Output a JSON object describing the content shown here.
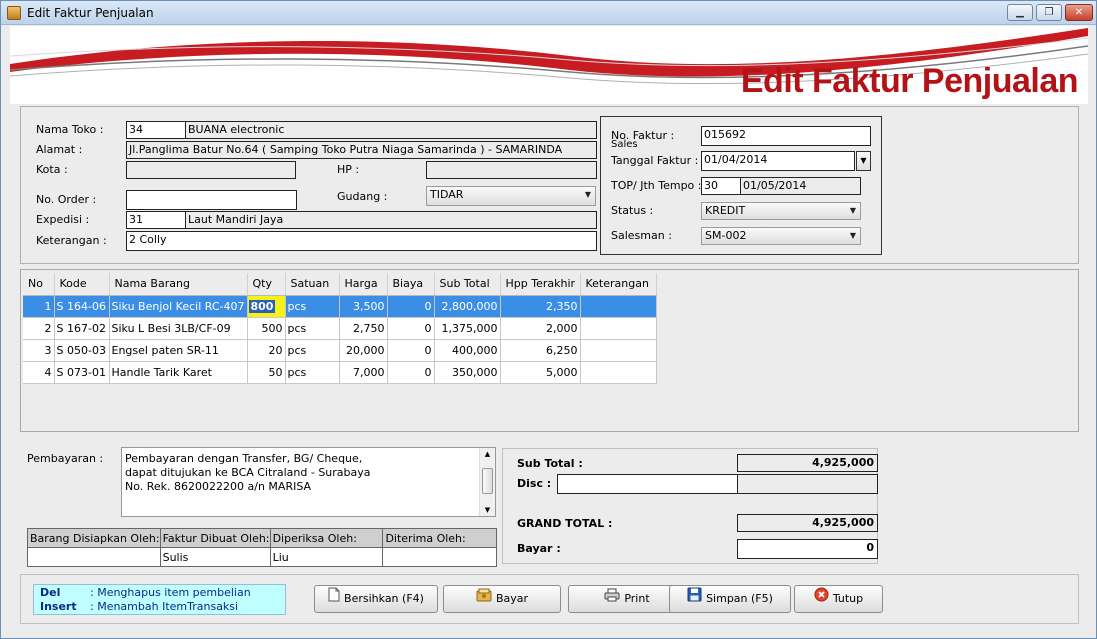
{
  "window": {
    "title": "Edit Faktur Penjualan"
  },
  "banner": {
    "title": "Edit Faktur Penjualan"
  },
  "customer": {
    "nama_toko_label": "Nama Toko :",
    "nama_toko_code": "34",
    "nama_toko_name": "BUANA electronic",
    "alamat_label": "Alamat :",
    "alamat_value": "Jl.Panglima Batur No.64  ( Samping Toko Putra Niaga Samarinda ) - SAMARINDA",
    "kota_label": "Kota :",
    "kota_value": "",
    "hp_label": "HP :",
    "hp_value": "",
    "no_order_label": "No. Order :",
    "no_order_value": "",
    "gudang_label": "Gudang :",
    "gudang_value": "TIDAR",
    "expedisi_label": "Expedisi :",
    "expedisi_code": "31",
    "expedisi_name": "Laut Mandiri Jaya",
    "keterangan_label": "Keterangan :",
    "keterangan_value": "2 Colly"
  },
  "invoice": {
    "no_faktur_label": "No. Faktur :",
    "sales_label": "Sales",
    "no_faktur_value": "015692",
    "tanggal_label": "Tanggal Faktur :",
    "tanggal_value": "01/04/2014",
    "top_label": "TOP/ Jth Tempo :",
    "top_days": "30",
    "jatuh_tempo": "01/05/2014",
    "status_label": "Status :",
    "status_value": "KREDIT",
    "salesman_label": "Salesman :",
    "salesman_value": "SM-002"
  },
  "items": {
    "columns": [
      "No",
      "Kode",
      "Nama Barang",
      "Qty",
      "Satuan",
      "Harga",
      "Biaya",
      "Sub Total",
      "Hpp Terakhir",
      "Keterangan"
    ],
    "rows": [
      {
        "no": "1",
        "kode": "S 164-06",
        "nama": "Siku Benjol Kecil RC-407",
        "qty": "800",
        "satuan": "pcs",
        "harga": "3,500",
        "biaya": "0",
        "subtotal": "2,800,000",
        "hpp": "2,350",
        "ket": ""
      },
      {
        "no": "2",
        "kode": "S 167-02",
        "nama": "Siku L Besi 3LB/CF-09",
        "qty": "500",
        "satuan": "pcs",
        "harga": "2,750",
        "biaya": "0",
        "subtotal": "1,375,000",
        "hpp": "2,000",
        "ket": ""
      },
      {
        "no": "3",
        "kode": "S 050-03",
        "nama": "Engsel paten SR-11",
        "qty": "20",
        "satuan": "pcs",
        "harga": "20,000",
        "biaya": "0",
        "subtotal": "400,000",
        "hpp": "6,250",
        "ket": ""
      },
      {
        "no": "4",
        "kode": "S 073-01",
        "nama": "Handle Tarik Karet",
        "qty": "50",
        "satuan": "pcs",
        "harga": "7,000",
        "biaya": "0",
        "subtotal": "350,000",
        "hpp": "5,000",
        "ket": ""
      }
    ]
  },
  "payment": {
    "label": "Pembayaran :",
    "line1": "Pembayaran dengan Transfer, BG/ Cheque,",
    "line2": "dapat ditujukan ke BCA Citraland - Surabaya",
    "line3": "No. Rek. 8620022200 a/n MARISA"
  },
  "signatures": {
    "headers": [
      "Barang Disiapkan Oleh:",
      "Faktur Dibuat Oleh:",
      "Diperiksa Oleh:",
      "Diterima Oleh:"
    ],
    "values": [
      "",
      "Sulis",
      "Liu",
      ""
    ]
  },
  "totals": {
    "subtotal_label": "Sub Total :",
    "subtotal_value": "4,925,000",
    "disc_label": "Disc :",
    "disc_value": "",
    "grand_label": "GRAND TOTAL :",
    "grand_value": "4,925,000",
    "bayar_label": "Bayar :",
    "bayar_value": "0"
  },
  "hints": {
    "del_key": "Del",
    "del_text": ":  Menghapus item pembelian",
    "insert_key": "Insert",
    "insert_text": ":  Menambah ItemTransaksi"
  },
  "buttons": {
    "bersihkan": "Bersihkan (F4)",
    "bayar": "Bayar",
    "print": "Print",
    "simpan": "Simpan (F5)",
    "tutup": "Tutup"
  },
  "colors": {
    "accent": "#b31217",
    "selection": "#3a8ee6",
    "hint_bg": "#bfffff"
  }
}
